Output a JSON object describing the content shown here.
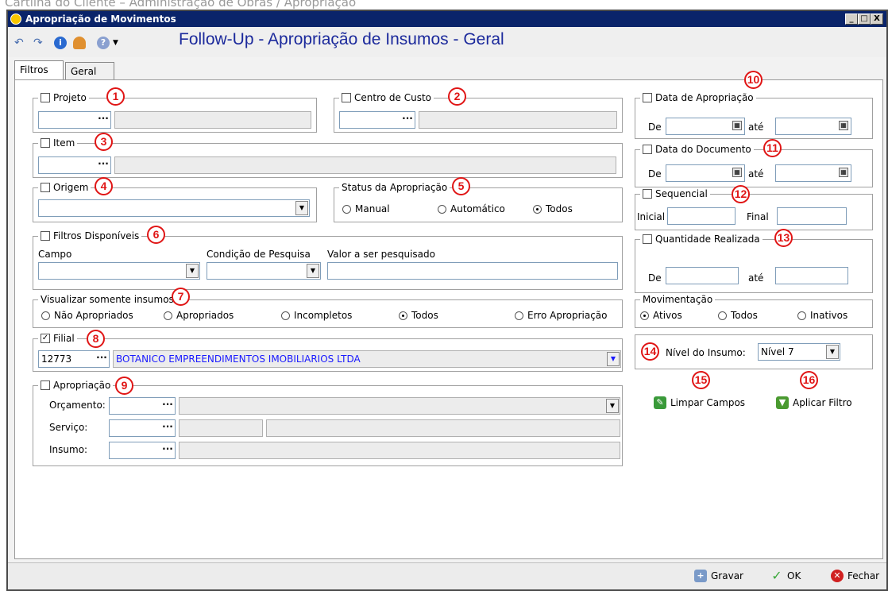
{
  "doc_header": "Cartilha do Cliente – Administração de Obras / Apropriação",
  "window": {
    "title": "Apropriação de Movimentos",
    "btn_min": "_",
    "btn_max": "□",
    "btn_close": "X"
  },
  "toolbar": {
    "heading": "Follow-Up - Apropriação de Insumos - Geral"
  },
  "tabs": [
    {
      "label": "Filtros"
    },
    {
      "label": "Geral"
    }
  ],
  "callouts": [
    "1",
    "2",
    "3",
    "4",
    "5",
    "6",
    "7",
    "8",
    "9",
    "10",
    "11",
    "12",
    "13",
    "14",
    "15",
    "16"
  ],
  "projeto": {
    "label": "Projeto"
  },
  "centro": {
    "label": "Centro de Custo"
  },
  "item": {
    "label": "Item"
  },
  "origem": {
    "label": "Origem"
  },
  "status": {
    "label": "Status da Apropriação",
    "options": [
      "Manual",
      "Automático",
      "Todos"
    ],
    "selected": "Todos"
  },
  "filtros": {
    "label": "Filtros Disponíveis",
    "col_campo": "Campo",
    "col_condicao": "Condição de Pesquisa",
    "col_valor": "Valor a ser pesquisado"
  },
  "visualizar": {
    "label": "Visualizar somente insumos",
    "options": [
      "Não Apropriados",
      "Apropriados",
      "Incompletos",
      "Todos",
      "Erro Apropriação"
    ],
    "selected": "Todos"
  },
  "filial": {
    "label": "Filial",
    "checked": true,
    "code": "12773",
    "name": "BOTANICO EMPREENDIMENTOS IMOBILIARIOS LTDA"
  },
  "apropriacao": {
    "label": "Apropriação",
    "orcamento": "Orçamento:",
    "servico": "Serviço:",
    "insumo": "Insumo:"
  },
  "data_apropriacao": {
    "label": "Data de Apropriação",
    "de": "De",
    "ate": "até"
  },
  "data_documento": {
    "label": "Data do Documento",
    "de": "De",
    "ate": "até"
  },
  "sequencial": {
    "label": "Sequencial",
    "inicial": "Inicial",
    "final": "Final"
  },
  "quantidade": {
    "label": "Quantidade Realizada",
    "de": "De",
    "ate": "até"
  },
  "movimentacao": {
    "label": "Movimentação",
    "options": [
      "Ativos",
      "Todos",
      "Inativos"
    ],
    "selected": "Ativos"
  },
  "nivel": {
    "label": "Nível do Insumo:",
    "value": "Nível 7"
  },
  "actions": {
    "limpar": "Limpar Campos",
    "aplicar": "Aplicar Filtro"
  },
  "bottom": {
    "gravar": "Gravar",
    "ok": "OK",
    "fechar": "Fechar"
  },
  "colors": {
    "title_bar": "#0a246a",
    "callout": "#e01515",
    "heading": "#1c2a9c",
    "link_text": "#1a1aff"
  }
}
